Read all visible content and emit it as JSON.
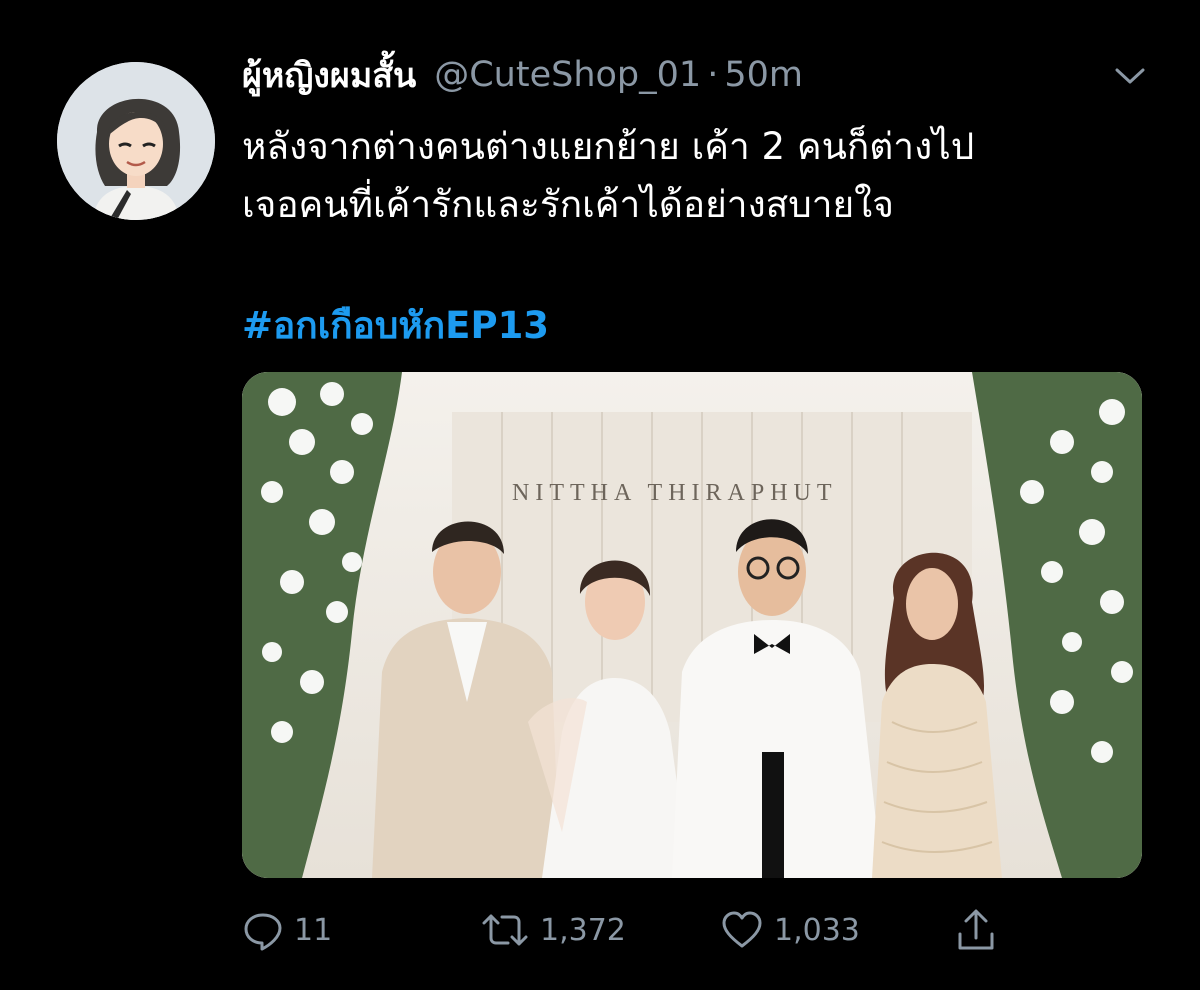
{
  "tweet": {
    "display_name": "ผู้หญิงผมสั้น",
    "handle": "@CuteShop_01",
    "separator": "·",
    "time": "50m",
    "text": "หลังจากต่างคนต่างแยกย้าย เค้า 2 คนก็ต่างไป\nเจอคนที่เค้ารักและรักเค้าได้อย่างสบายใจ",
    "hashtag": "#อกเกือบหักEP13",
    "media": {
      "sign_text": "NITTHA THIRAPHUT"
    },
    "actions": {
      "reply_count": "11",
      "retweet_count": "1,372",
      "like_count": "1,033"
    }
  },
  "colors": {
    "background": "#000000",
    "text": "#ffffff",
    "secondary": "#8b98a5",
    "link": "#1d9bf0"
  },
  "icons": {
    "more": "chevron-down-icon",
    "reply": "reply-icon",
    "retweet": "retweet-icon",
    "like": "heart-icon",
    "share": "share-icon"
  }
}
